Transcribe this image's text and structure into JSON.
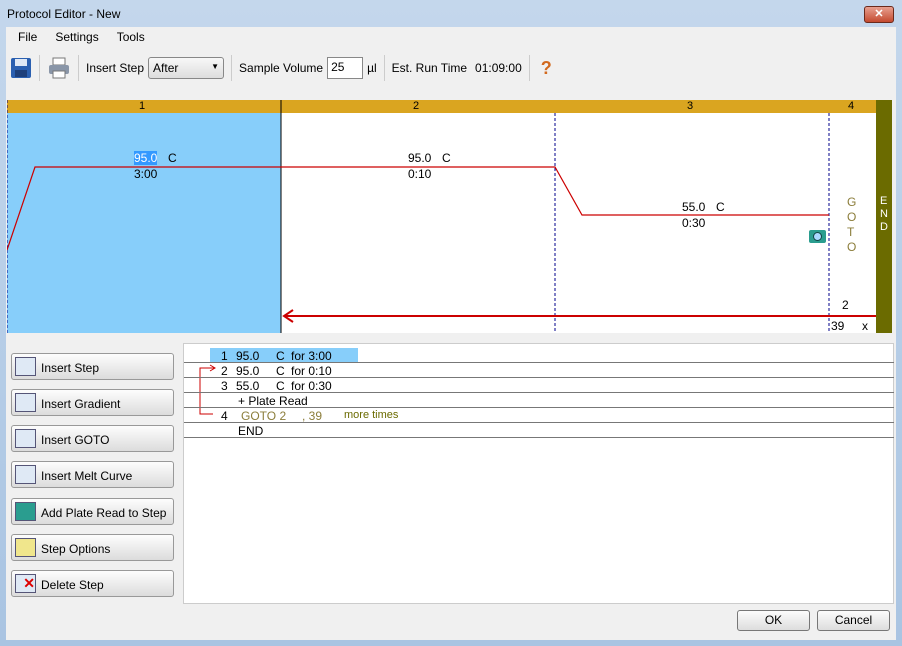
{
  "window": {
    "title": "Protocol Editor - New",
    "close": "✕"
  },
  "menu": [
    "File",
    "Settings",
    "Tools"
  ],
  "toolbar": {
    "insert_step_label": "Insert Step",
    "insert_step_value": "After",
    "sample_volume_label": "Sample Volume",
    "sample_volume": "25",
    "unit": "µl",
    "run_time_label": "Est. Run Time",
    "run_time": "01:09:00",
    "help": "?"
  },
  "graph": {
    "steps": [
      {
        "num": "1",
        "temp": "95.0",
        "unit": "C",
        "time": "3:00"
      },
      {
        "num": "2",
        "temp": "95.0",
        "unit": "C",
        "time": "0:10"
      },
      {
        "num": "3",
        "temp": "55.0",
        "unit": "C",
        "time": "0:30"
      },
      {
        "num": "4"
      }
    ],
    "goto_label": "GOTO",
    "goto_target": "2",
    "goto_count": "39",
    "goto_x": "x",
    "end_label": "END",
    "colors": {
      "header": "#DAA520",
      "selected": "#87CEFA",
      "line": "#CC0000",
      "end": "#6B6B00"
    }
  },
  "side_buttons": [
    "Insert Step",
    "Insert Gradient",
    "Insert GOTO",
    "Insert Melt Curve",
    "Add Plate Read to Step",
    "Step Options",
    "Delete Step"
  ],
  "list": [
    {
      "num": "1",
      "temp": "95.0",
      "unit": "C",
      "time": "for 3:00"
    },
    {
      "num": "2",
      "temp": "95.0",
      "unit": "C",
      "time": "for 0:10"
    },
    {
      "num": "3",
      "temp": "55.0",
      "unit": "C",
      "time": "for 0:30"
    },
    {
      "extra": "+ Plate Read"
    },
    {
      "num": "4",
      "goto": "GOTO 2",
      "count": ", 39",
      "more": "more times"
    },
    {
      "extra": "END"
    }
  ],
  "footer": {
    "ok": "OK",
    "cancel": "Cancel"
  }
}
